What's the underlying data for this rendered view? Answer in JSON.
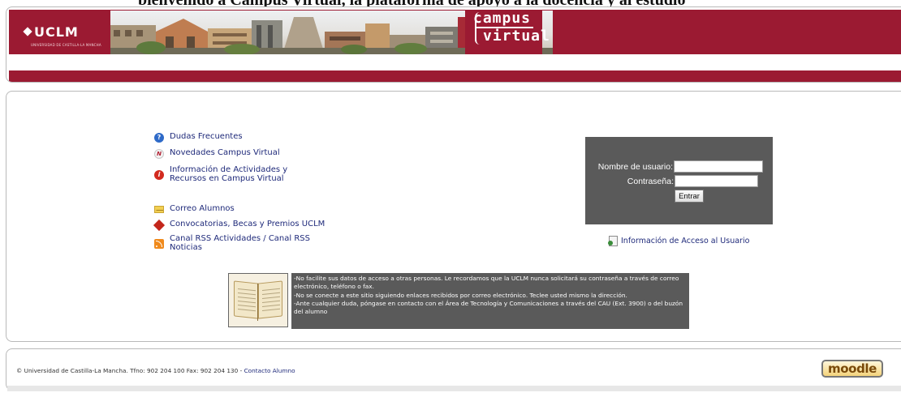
{
  "page": {
    "top_title_fragment": "bienvenido a Campus Virtual, la plataforma de apoyo a la docencia y al estudio"
  },
  "header": {
    "logo_text": "UCLM",
    "logo_subtitle": "UNIVERSIDAD DE CASTILLA-LA MANCHA",
    "campus_word": "campus",
    "virtual_word": "virtual",
    "brand_color": "#9b1a32"
  },
  "links": [
    {
      "label": "Dudas Frecuentes",
      "icon": "question-icon"
    },
    {
      "label": "Novedades Campus Virtual",
      "icon": "news-icon"
    },
    {
      "label": "Información de Actividades y Recursos en Campus Virtual",
      "icon": "info-icon"
    },
    {
      "label": "Correo Alumnos",
      "icon": "mail-icon"
    },
    {
      "label": "Convocatorias, Becas y Premios UCLM",
      "icon": "diamond-icon"
    },
    {
      "label": "Canal RSS Actividades / Canal RSS Noticias",
      "icon": "rss-icon"
    }
  ],
  "login": {
    "username_label": "Nombre de usuario:",
    "password_label": "Contraseña:",
    "username_value": "",
    "password_value": "",
    "submit_label": "Entrar"
  },
  "access_info_label": "Información de Acceso al Usuario",
  "notice": {
    "lines": [
      "-No facilite sus datos de acceso a otras personas. Le recordamos que la UCLM nunca solicitará su contraseña a través de correo electrónico, teléfono o fax.",
      "-No se conecte a este sitio siguiendo enlaces recibidos por correo electrónico. Teclee usted mismo la dirección.",
      "-Ante cualquier duda, póngase en contacto con el Área de Tecnología y Comunicaciones a través del CAU (Ext. 3900) o del buzón del alumno"
    ]
  },
  "footer": {
    "copyright": "© Universidad de Castilla-La Mancha. Tfno: 902 204 100 Fax: 902 204 130 - ",
    "contact_link": "Contacto Alumno",
    "moodle_label": "moodle"
  }
}
